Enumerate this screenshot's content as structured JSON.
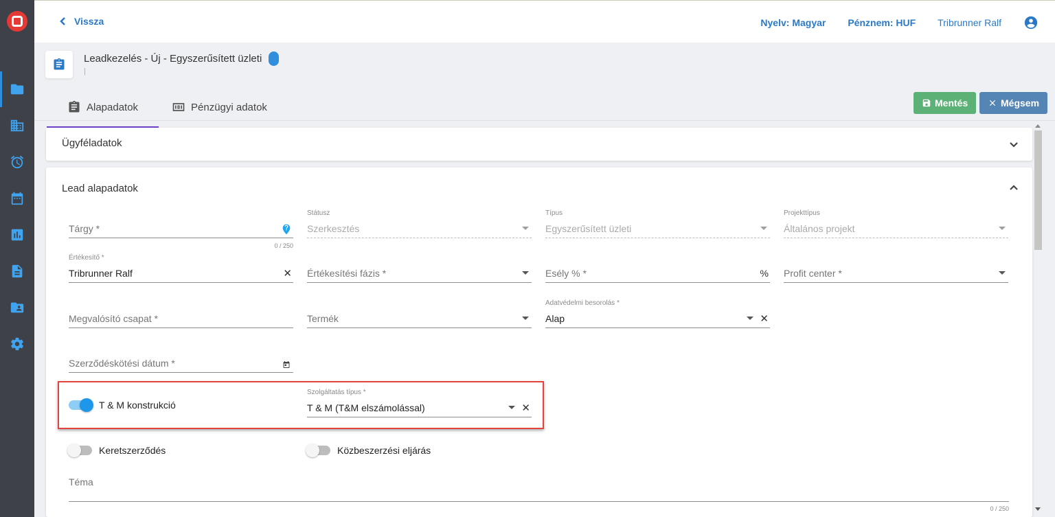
{
  "topbar": {
    "back_label": "Vissza",
    "language": "Nyelv: Magyar",
    "currency": "Pénznem: HUF",
    "user_name": "Tribrunner Ralf"
  },
  "page": {
    "title": "Leadkezelés - Új - Egyszerűsített üzleti",
    "subtitle": "|"
  },
  "tabs": [
    {
      "label": "Alapadatok",
      "active": true
    },
    {
      "label": "Pénzügyi adatok",
      "active": false
    }
  ],
  "actions": {
    "save_label": "Mentés",
    "cancel_label": "Mégsem"
  },
  "sections": {
    "customer": {
      "title": "Ügyféladatok"
    },
    "lead": {
      "title": "Lead alapadatok"
    }
  },
  "fields": {
    "subject": {
      "placeholder": "Tárgy *",
      "counter": "0 / 250"
    },
    "status": {
      "label": "Státusz",
      "value": "Szerkesztés"
    },
    "type": {
      "label": "Típus",
      "value": "Egyszerűsített üzleti"
    },
    "project_type": {
      "label": "Projekttípus",
      "value": "Általános projekt"
    },
    "sales_person": {
      "label": "Értékesítő *",
      "value": "Tribrunner Ralf"
    },
    "sales_phase": {
      "placeholder": "Értékesítési fázis *"
    },
    "probability": {
      "placeholder": "Esély % *",
      "suffix": "%"
    },
    "profit_center": {
      "placeholder": "Profit center *"
    },
    "team": {
      "placeholder": "Megvalósító csapat *"
    },
    "product": {
      "placeholder": "Termék"
    },
    "privacy": {
      "label": "Adatvédelmi besorolás *",
      "value": "Alap"
    },
    "contract_date": {
      "placeholder": "Szerződéskötési dátum *"
    },
    "service_type": {
      "label": "Szolgáltatás típus *",
      "value": "T & M (T&M elszámolással)"
    },
    "topic": {
      "placeholder": "Téma",
      "counter": "0 / 250"
    }
  },
  "toggles": {
    "tm": {
      "label": "T & M konstrukció",
      "on": true
    },
    "frame": {
      "label": "Keretszerződés",
      "on": false
    },
    "procurement": {
      "label": "Közbeszerzési eljárás",
      "on": false
    }
  },
  "colors": {
    "accent": "#2a79c7",
    "save": "#5cb176",
    "cancel": "#5585b5",
    "highlight": "#e2433b",
    "tab_underline": "#6d42c7"
  }
}
